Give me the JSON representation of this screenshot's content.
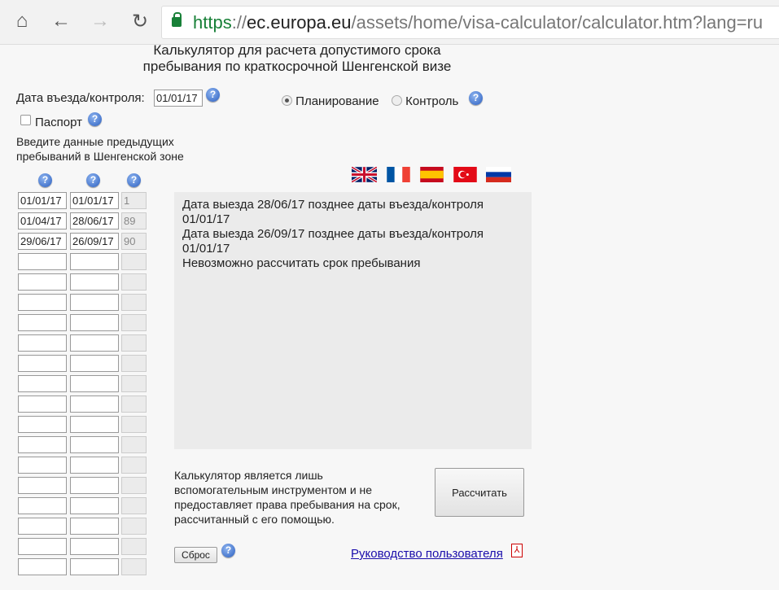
{
  "browser": {
    "url_scheme": "https",
    "url_sep": "://",
    "url_domain": "ec.europa.eu",
    "url_path": "/assets/home/visa-calculator/calculator.htm?lang=ru"
  },
  "page": {
    "title_line1": "Калькулятор для расчета допустимого срока",
    "title_line2": "пребывания по краткосрочной Шенгенской визе",
    "entry_label": "Дата въезда/контроля:",
    "entry_value": "01/01/17",
    "passport_label": "Паспорт",
    "mode_planning": "Планирование",
    "mode_control": "Контроль",
    "instructions_line1": "Введите данные предыдущих",
    "instructions_line2": "пребываний в Шенгенской зоне",
    "help": "?",
    "rows": [
      {
        "entry": "01/01/17",
        "exit": "01/01/17",
        "days": "1"
      },
      {
        "entry": "01/04/17",
        "exit": "28/06/17",
        "days": "89"
      },
      {
        "entry": "29/06/17",
        "exit": "26/09/17",
        "days": "90"
      }
    ],
    "messages": [
      "Дата выезда 28/06/17 позднее даты въезда/контроля 01/01/17",
      "Дата выезда 26/09/17 позднее даты въезда/контроля 01/01/17",
      "Невозможно рассчитать срок пребывания"
    ],
    "disclaimer": "Калькулятор является лишь вспомогательным инструментом и не предоставляет права пребывания на срок, рассчитанный с его помощью.",
    "calculate": "Рассчитать",
    "reset": "Сброс",
    "guide_link": "Руководство пользователя"
  }
}
